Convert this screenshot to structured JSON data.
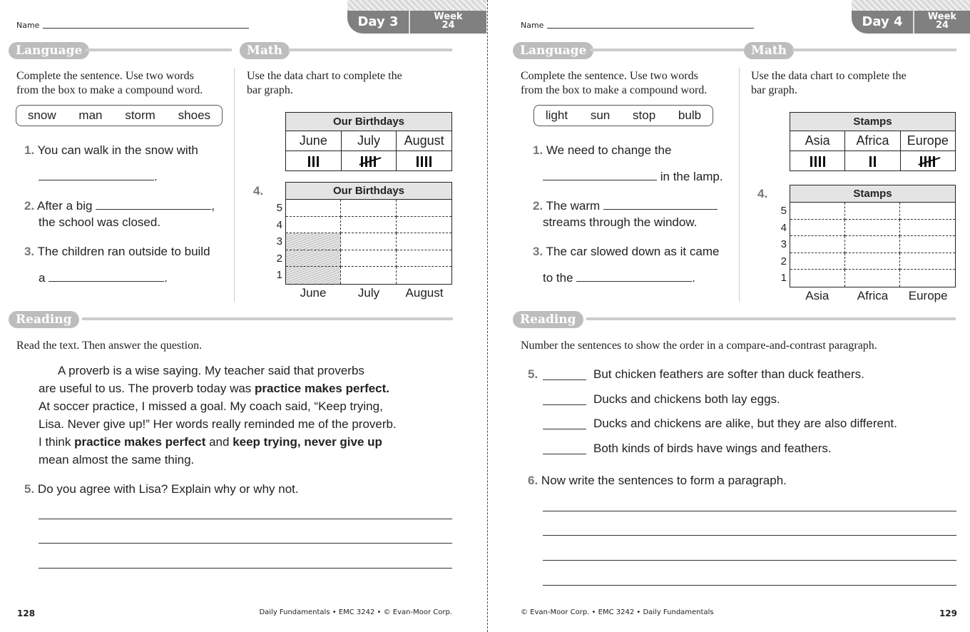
{
  "pages": [
    {
      "name_label": "Name",
      "day": "Day 3",
      "week_label": "Week",
      "week_num": "24",
      "language": {
        "title": "Language",
        "instruction": [
          "Complete the sentence. Use two words",
          "from the box to make a compound word."
        ],
        "words": [
          "snow",
          "man",
          "storm",
          "shoes"
        ],
        "q1": {
          "num": "1.",
          "text": "You can walk in the snow with",
          "end": "."
        },
        "q2": {
          "num": "2.",
          "text": "After a big",
          "mid": ",",
          "text2": "the school was closed."
        },
        "q3": {
          "num": "3.",
          "text": "The children ran outside to build",
          "text2": "a",
          "end": "."
        }
      },
      "math": {
        "title": "Math",
        "instruction": [
          "Use the data chart to complete the",
          "bar graph."
        ],
        "table_title": "Our Birthdays",
        "categories": [
          "June",
          "July",
          "August"
        ],
        "tallies": [
          3,
          5,
          4
        ],
        "q_num": "4.",
        "graph_title": "Our Birthdays",
        "y_ticks": [
          "5",
          "4",
          "3",
          "2",
          "1"
        ],
        "shaded": [
          3,
          0,
          0
        ]
      },
      "reading": {
        "title": "Reading",
        "instruction": "Read the text. Then answer the question.",
        "paragraph": [
          [
            {
              "t": "A proverb is a wise saying. My teacher said that proverbs"
            }
          ],
          [
            {
              "t": "are useful to us. The proverb today was "
            },
            {
              "t": "practice makes perfect.",
              "b": true
            }
          ],
          [
            {
              "t": "At soccer practice, I missed a goal. My coach said, “Keep trying,"
            }
          ],
          [
            {
              "t": "Lisa. Never give up!” Her words really reminded me of the proverb."
            }
          ],
          [
            {
              "t": "I think "
            },
            {
              "t": "practice makes perfect",
              "b": true
            },
            {
              "t": " and "
            },
            {
              "t": "keep trying, never give up",
              "b": true
            }
          ],
          [
            {
              "t": "mean almost the same thing."
            }
          ]
        ],
        "q5": {
          "num": "5.",
          "text": "Do you agree with Lisa? Explain why or why not."
        }
      },
      "footer": {
        "page": "128",
        "text": "Daily Fundamentals • EMC 3242 • © Evan-Moor Corp."
      }
    },
    {
      "name_label": "Name",
      "day": "Day 4",
      "week_label": "Week",
      "week_num": "24",
      "language": {
        "title": "Language",
        "instruction": [
          "Complete the sentence. Use two words",
          "from the box to make a compound word."
        ],
        "words": [
          "light",
          "sun",
          "stop",
          "bulb"
        ],
        "q1": {
          "num": "1.",
          "text": "We need to change the",
          "text2": "in the lamp."
        },
        "q2": {
          "num": "2.",
          "text": "The warm",
          "text2": "streams through the window."
        },
        "q3": {
          "num": "3.",
          "text": "The car slowed down as it came",
          "text2": "to the",
          "end": "."
        }
      },
      "math": {
        "title": "Math",
        "instruction": [
          "Use the data chart to complete the",
          "bar graph."
        ],
        "table_title": "Stamps",
        "categories": [
          "Asia",
          "Africa",
          "Europe"
        ],
        "tallies": [
          4,
          2,
          5
        ],
        "q_num": "4.",
        "graph_title": "Stamps",
        "y_ticks": [
          "5",
          "4",
          "3",
          "2",
          "1"
        ],
        "shaded": [
          0,
          0,
          0
        ]
      },
      "reading": {
        "title": "Reading",
        "instruction": "Number the sentences to show the order in a compare-and-contrast paragraph.",
        "q5_num": "5.",
        "sentences": [
          "But chicken feathers are softer than duck feathers.",
          "Ducks and chickens both lay eggs.",
          "Ducks and chickens are alike, but they are also different.",
          "Both kinds of birds have wings and feathers."
        ],
        "q6": {
          "num": "6.",
          "text": "Now write the sentences to form a paragraph."
        }
      },
      "footer": {
        "page": "129",
        "text": "© Evan-Moor Corp. • EMC 3242 • Daily Fundamentals"
      }
    }
  ]
}
